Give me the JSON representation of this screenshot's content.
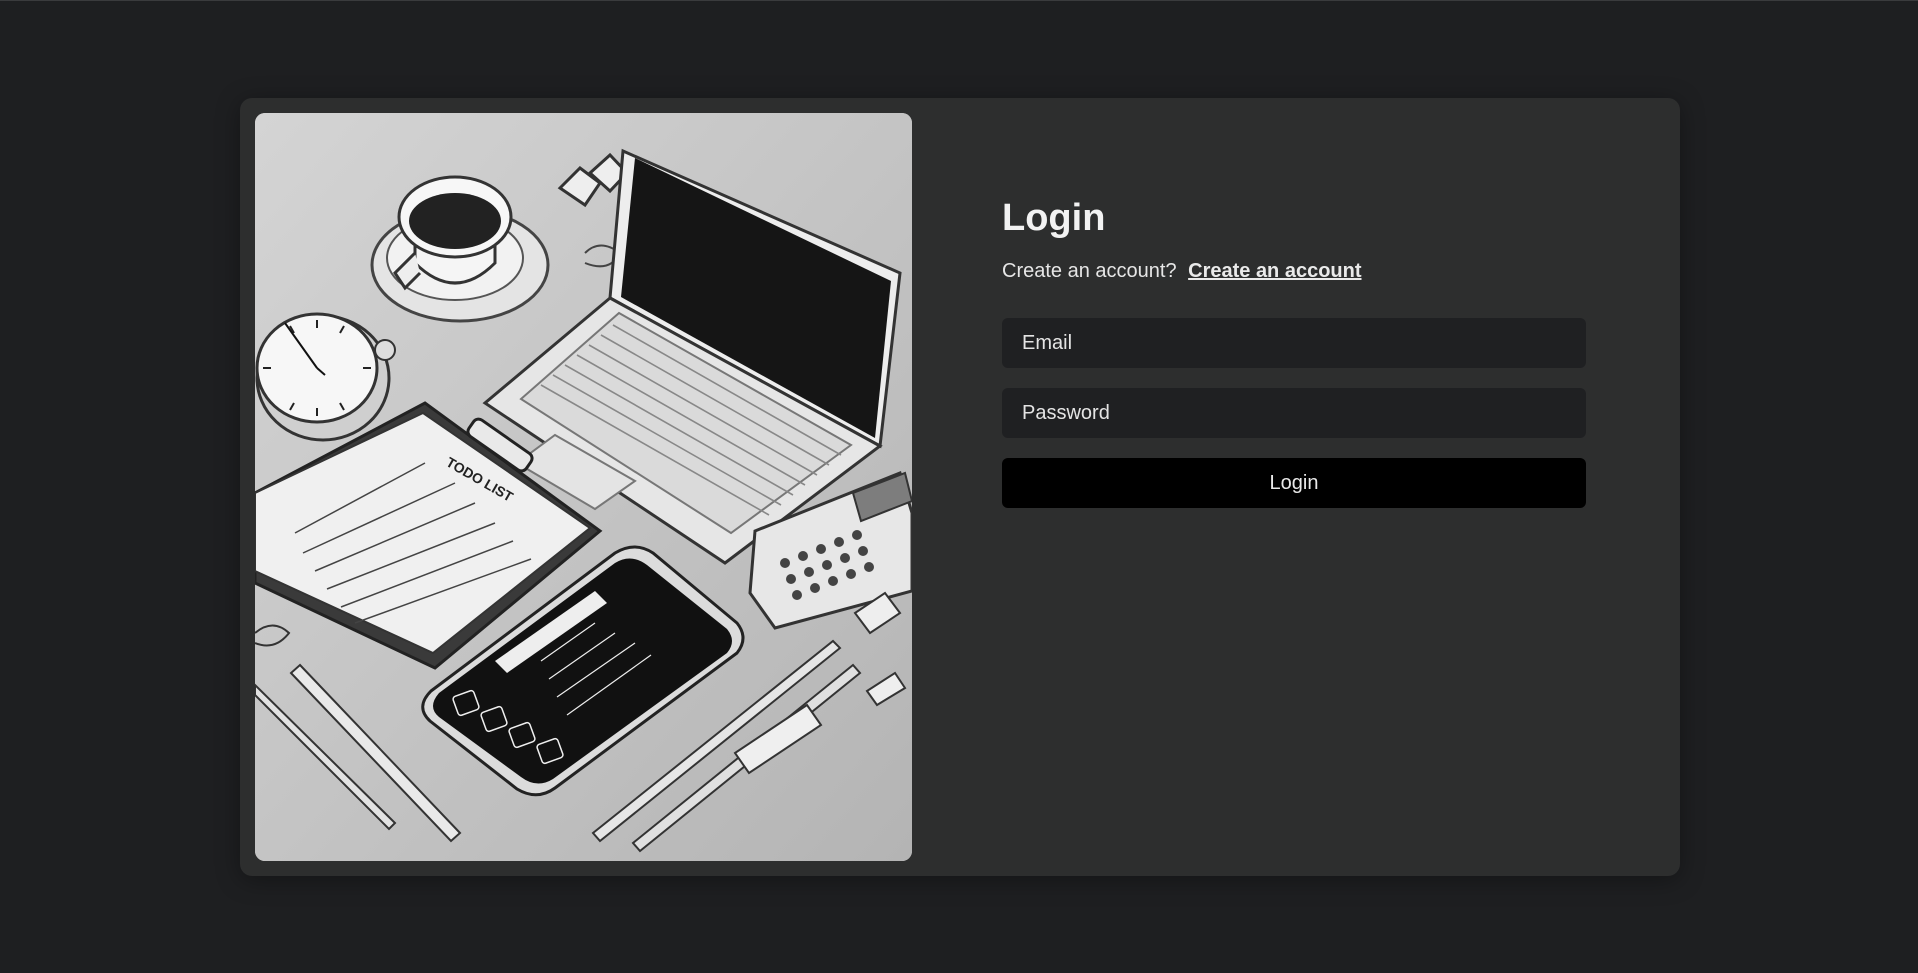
{
  "login": {
    "title": "Login",
    "prompt": "Create an account?",
    "create_link": "Create an account",
    "email_placeholder": "Email",
    "password_placeholder": "Password",
    "submit_label": "Login"
  },
  "hero": {
    "todo_label": "TODO LIST"
  },
  "colors": {
    "page_bg": "#1e1f21",
    "card_bg": "#2d2e2e",
    "input_bg": "#1f2022",
    "button_bg": "#000000"
  }
}
